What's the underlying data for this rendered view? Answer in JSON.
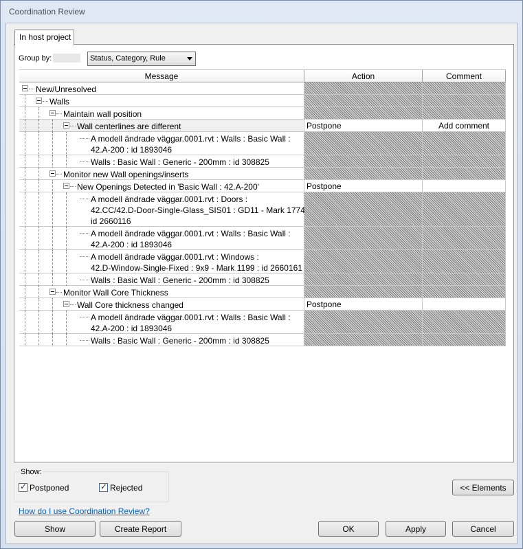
{
  "window": {
    "title": "Coordination Review"
  },
  "tab": {
    "label": "In host project"
  },
  "groupby": {
    "label": "Group by:",
    "value": "Status, Category, Rule"
  },
  "columns": {
    "message": "Message",
    "action": "Action",
    "comment": "Comment"
  },
  "rows": [
    {
      "level": 0,
      "expander": true,
      "lines": [
        "New/Unresolved"
      ],
      "action": "",
      "comment": "",
      "hatch": true
    },
    {
      "level": 1,
      "expander": true,
      "lines": [
        "Walls"
      ],
      "action": "",
      "comment": "",
      "hatch": true
    },
    {
      "level": 2,
      "expander": true,
      "lines": [
        "Maintain wall position"
      ],
      "action": "",
      "comment": "",
      "hatch": true
    },
    {
      "level": 3,
      "expander": true,
      "lines": [
        "Wall centerlines are different"
      ],
      "action": "Postpone",
      "comment": "Add comment",
      "hatch": false,
      "selected": true
    },
    {
      "level": 4,
      "expander": false,
      "lines": [
        "A modell ändrade väggar.0001.rvt : Walls : Basic Wall :",
        "42.A-200 : id 1893046"
      ],
      "action": "",
      "comment": "",
      "hatch": true
    },
    {
      "level": 4,
      "expander": false,
      "lines": [
        "Walls : Basic Wall : Generic - 200mm : id 308825"
      ],
      "action": "",
      "comment": "",
      "hatch": true
    },
    {
      "level": 2,
      "expander": true,
      "lines": [
        "Monitor new Wall openings/inserts"
      ],
      "action": "",
      "comment": "",
      "hatch": true
    },
    {
      "level": 3,
      "expander": true,
      "lines": [
        "New Openings Detected in 'Basic Wall : 42.A-200'"
      ],
      "action": "Postpone",
      "comment": "",
      "hatch": false
    },
    {
      "level": 4,
      "expander": false,
      "lines": [
        "A modell ändrade väggar.0001.rvt : Doors :",
        "42.CC/42.D-Door-Single-Glass_SIS01 : GD11 - Mark 1774 :",
        "id 2660116"
      ],
      "action": "",
      "comment": "",
      "hatch": true
    },
    {
      "level": 4,
      "expander": false,
      "lines": [
        "A modell ändrade väggar.0001.rvt : Walls : Basic Wall :",
        "42.A-200 : id 1893046"
      ],
      "action": "",
      "comment": "",
      "hatch": true
    },
    {
      "level": 4,
      "expander": false,
      "lines": [
        "A modell ändrade väggar.0001.rvt : Windows :",
        "42.D-Window-Single-Fixed : 9x9 - Mark 1199 : id 2660161"
      ],
      "action": "",
      "comment": "",
      "hatch": true
    },
    {
      "level": 4,
      "expander": false,
      "lines": [
        "Walls : Basic Wall : Generic - 200mm : id 308825"
      ],
      "action": "",
      "comment": "",
      "hatch": true
    },
    {
      "level": 2,
      "expander": true,
      "lines": [
        "Monitor Wall Core Thickness"
      ],
      "action": "",
      "comment": "",
      "hatch": true
    },
    {
      "level": 3,
      "expander": true,
      "lines": [
        "Wall Core thickness changed"
      ],
      "action": "Postpone",
      "comment": "",
      "hatch": false
    },
    {
      "level": 4,
      "expander": false,
      "lines": [
        "A modell ändrade väggar.0001.rvt : Walls : Basic Wall :",
        "42.A-200 : id 1893046"
      ],
      "action": "",
      "comment": "",
      "hatch": true
    },
    {
      "level": 4,
      "expander": false,
      "lines": [
        "Walls : Basic Wall : Generic - 200mm : id 308825"
      ],
      "action": "",
      "comment": "",
      "hatch": true
    }
  ],
  "show": {
    "label": "Show:",
    "postponed": "Postponed",
    "rejected": "Rejected",
    "postponed_checked": true,
    "rejected_checked": true
  },
  "help_link": "How do I use Coordination Review?",
  "buttons": {
    "elements": "<< Elements",
    "show": "Show",
    "create_report": "Create Report",
    "ok": "OK",
    "apply": "Apply",
    "cancel": "Cancel"
  }
}
